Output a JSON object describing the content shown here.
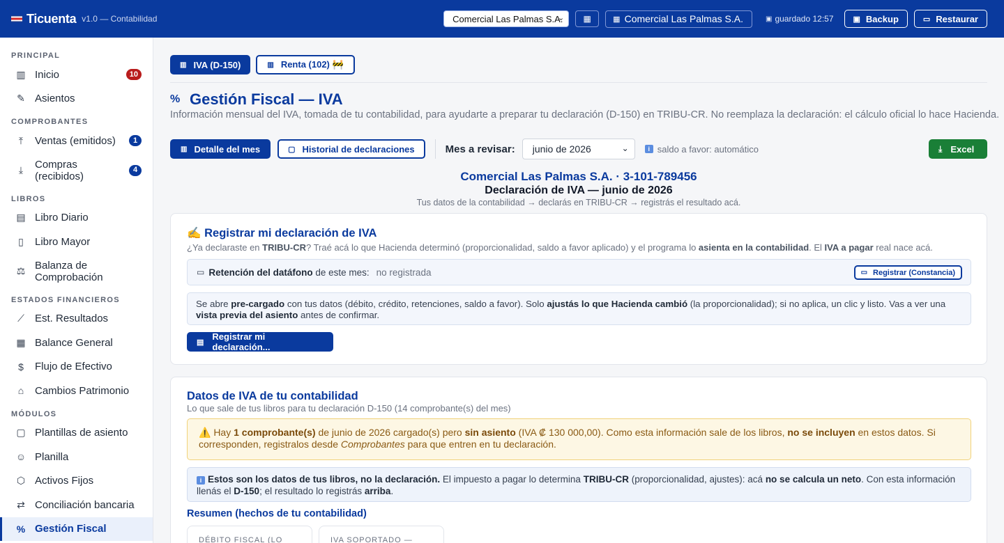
{
  "header": {
    "brand": "Ticuenta",
    "version": "v1.0 — Contabilidad",
    "company_select": "Comercial Las Palmas S.A.",
    "company_chip": "Comercial Las Palmas S.A.",
    "saved": "guardado 12:57",
    "backup": "Backup",
    "restore": "Restaurar"
  },
  "sidebar": {
    "sections": {
      "principal": "PRINCIPAL",
      "comprobantes": "COMPROBANTES",
      "libros": "LIBROS",
      "estados": "ESTADOS FINANCIEROS",
      "modulos": "MÓDULOS"
    },
    "items": {
      "inicio": "Inicio",
      "inicio_badge": "10",
      "asientos": "Asientos",
      "ventas": "Ventas (emitidos)",
      "ventas_badge": "1",
      "compras": "Compras (recibidos)",
      "compras_badge": "4",
      "diario": "Libro Diario",
      "mayor": "Libro Mayor",
      "balanza": "Balanza de Comprobación",
      "resultados": "Est. Resultados",
      "balance": "Balance General",
      "flujo": "Flujo de Efectivo",
      "cambios": "Cambios Patrimonio",
      "plantillas": "Plantillas de asiento",
      "planilla": "Planilla",
      "activos": "Activos Fijos",
      "conciliacion": "Conciliación bancaria",
      "fiscal": "Gestión Fiscal"
    }
  },
  "tabs": {
    "iva": "IVA (D-150)",
    "renta": "Renta (102) 🚧"
  },
  "page": {
    "title": "Gestión Fiscal — IVA",
    "subtitle": "Información mensual del IVA, tomada de tu contabilidad, para ayudarte a preparar tu declaración (D-150) en TRIBU-CR. No reemplaza la declaración: el cálculo oficial lo hace Hacienda."
  },
  "toolbar": {
    "detalle": "Detalle del mes",
    "historial": "Historial de declaraciones",
    "mes_label": "Mes a revisar:",
    "mes_value": "junio de 2026",
    "hint": "saldo a favor: automático",
    "excel": "Excel"
  },
  "summary_header": {
    "company": "Comercial Las Palmas S.A. · 3-101-789456",
    "declaration": "Declaración de IVA — junio de 2026",
    "flow": "Tus datos de la contabilidad → declarás en TRIBU-CR → registrás el resultado acá."
  },
  "register_card": {
    "title": "✍️ Registrar mi declaración de IVA",
    "desc_1": "¿Ya declaraste en ",
    "desc_b1": "TRIBU-CR",
    "desc_2": "? Traé acá lo que Hacienda determinó (proporcionalidad, saldo a favor aplicado) y el programa lo ",
    "desc_b2": "asienta en la contabilidad",
    "desc_3": ". El ",
    "desc_b3": "IVA a pagar",
    "desc_4": " real nace acá.",
    "retention_label": "Retención del datáfono",
    "retention_suffix": " de este mes:",
    "retention_value": "no registrada",
    "retention_button": "Registrar (Constancia)",
    "pre_1": "Se abre ",
    "pre_b1": "pre-cargado",
    "pre_2": " con tus datos (débito, crédito, retenciones, saldo a favor). Solo ",
    "pre_b2": "ajustás lo que Hacienda cambió",
    "pre_3": " (la proporcionalidad); si no aplica, un clic y listo. Vas a ver una ",
    "pre_b3": "vista previa del asiento",
    "pre_4": " antes de confirmar.",
    "register_button": "Registrar mi declaración..."
  },
  "data_card": {
    "title": "Datos de IVA de tu contabilidad",
    "desc": "Lo que sale de tus libros para tu declaración D-150 (14 comprobante(s) del mes)",
    "warn_1": "⚠️ Hay ",
    "warn_b1": "1 comprobante(s)",
    "warn_2": " de junio de 2026 cargado(s) pero ",
    "warn_b2": "sin asiento",
    "warn_3": " (IVA ₡ 130 000,00). Como esta información sale de los libros, ",
    "warn_b3": "no se incluyen",
    "warn_4": " en estos datos. Si corresponden, registralos desde ",
    "warn_i": "Comprobantes",
    "warn_5": " para que entren en tu declaración.",
    "note_b1": "Estos son los datos de tus libros, no la declaración.",
    "note_1": " El impuesto a pagar lo determina ",
    "note_b2": "TRIBU-CR",
    "note_2": " (proporcionalidad, ajustes): acá ",
    "note_b3": "no se calcula un neto",
    "note_3": ". Con esta información llenás el ",
    "note_b4": "D-150",
    "note_4": "; el resultado lo registrás ",
    "note_b5": "arriba",
    "note_5": ".",
    "resumen": "Resumen (hechos de tu contabilidad)",
    "stat1": "DÉBITO FISCAL (LO QUE",
    "stat2": "IVA SOPORTADO —"
  },
  "colors": {
    "primary": "#0a3a9e",
    "success": "#1a7f37",
    "badge_red": "#b91c1c",
    "warn_bg": "#fdf7e4"
  }
}
